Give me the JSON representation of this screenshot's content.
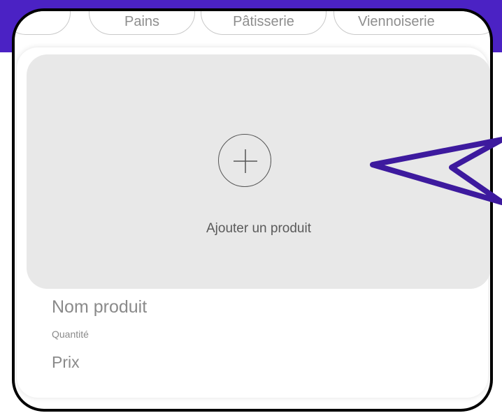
{
  "categories": [
    "Pains",
    "Pâtisserie",
    "Viennoiserie"
  ],
  "add_product": {
    "icon": "plus-circle-icon",
    "label": "Ajouter un produit"
  },
  "product": {
    "name_placeholder": "Nom produit",
    "quantity_placeholder": "Quantité",
    "price_placeholder": "Prix"
  },
  "colors": {
    "accent": "#4b22c4",
    "annotation_arrow": "#3d1a9e",
    "add_area_bg": "#e8e8e8",
    "muted_text": "#8a8a8a"
  }
}
